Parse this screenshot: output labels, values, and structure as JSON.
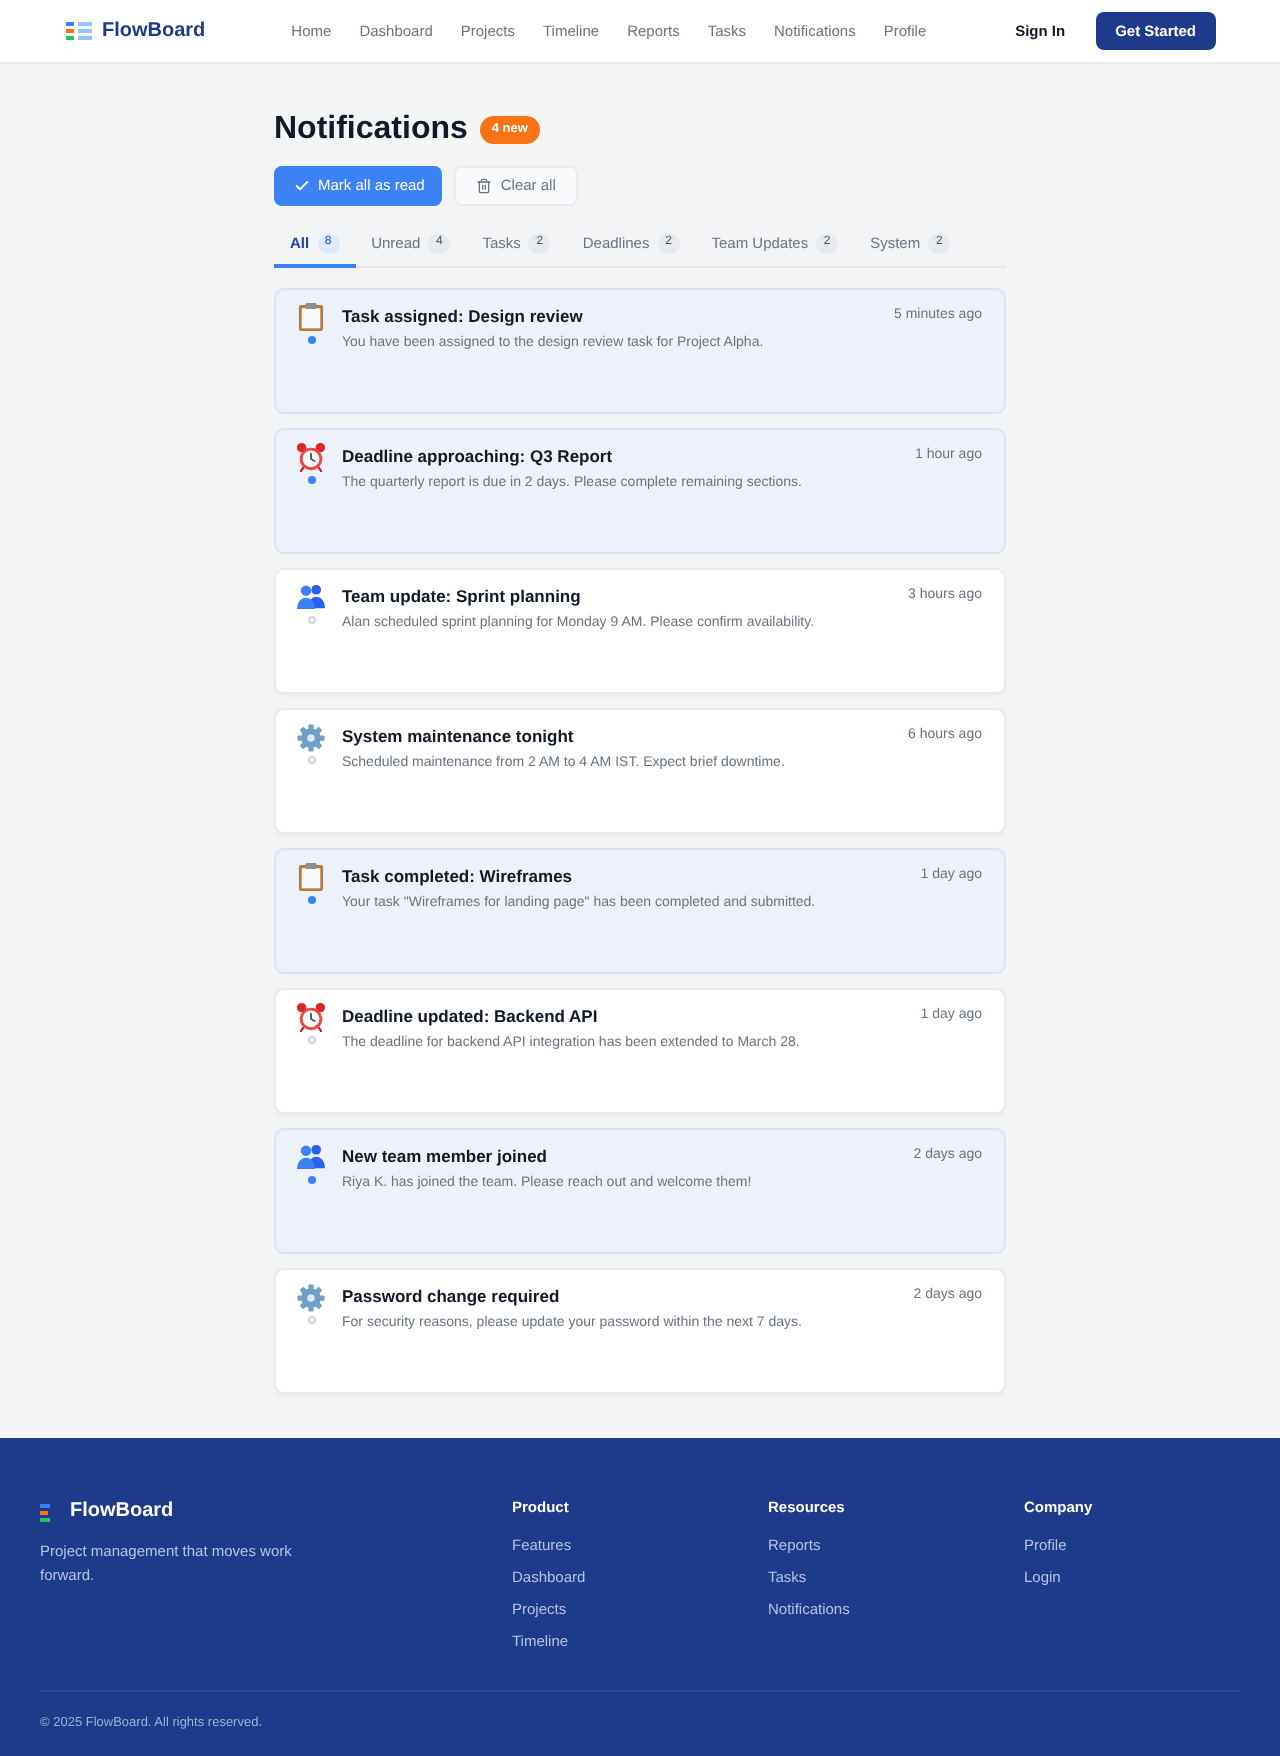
{
  "header": {
    "brand": "FlowBoard",
    "nav": [
      "Home",
      "Dashboard",
      "Projects",
      "Timeline",
      "Reports",
      "Tasks",
      "Notifications",
      "Profile"
    ],
    "sign_in": "Sign In",
    "cta": "Get Started"
  },
  "page": {
    "title": "Notifications",
    "badge": "4 new",
    "actions": [
      {
        "kind": "mark_read",
        "label": "Mark all as read"
      },
      {
        "kind": "clear",
        "label": "Clear all"
      }
    ]
  },
  "tabs": [
    {
      "label": "All",
      "count": "8",
      "selected": true
    },
    {
      "label": "Unread",
      "count": "4",
      "selected": false
    },
    {
      "label": "Tasks",
      "count": "2",
      "selected": false
    },
    {
      "label": "Deadlines",
      "count": "2",
      "selected": false
    },
    {
      "label": "Team Updates",
      "count": "2",
      "selected": false
    },
    {
      "label": "System",
      "count": "2",
      "selected": false
    }
  ],
  "notifications": [
    {
      "kind": "task",
      "title": "Task assigned: Design review",
      "message": "You have been assigned to the design review task for Project Alpha.",
      "time": "5 minutes ago",
      "unread": true
    },
    {
      "kind": "deadline",
      "title": "Deadline approaching: Q3 Report",
      "message": "The quarterly report is due in 2 days. Please complete remaining sections.",
      "time": "1 hour ago",
      "unread": true
    },
    {
      "kind": "team",
      "title": "Team update: Sprint planning",
      "message": "Alan scheduled sprint planning for Monday 9 AM. Please confirm availability.",
      "time": "3 hours ago",
      "unread": false
    },
    {
      "kind": "system",
      "title": "System maintenance tonight",
      "message": "Scheduled maintenance from 2 AM to 4 AM IST. Expect brief downtime.",
      "time": "6 hours ago",
      "unread": false
    },
    {
      "kind": "task",
      "title": "Task completed: Wireframes",
      "message": "Your task \"Wireframes for landing page\" has been completed and submitted.",
      "time": "1 day ago",
      "unread": true
    },
    {
      "kind": "deadline",
      "title": "Deadline updated: Backend API",
      "message": "The deadline for backend API integration has been extended to March 28.",
      "time": "1 day ago",
      "unread": false
    },
    {
      "kind": "team",
      "title": "New team member joined",
      "message": "Riya K. has joined the team. Please reach out and welcome them!",
      "time": "2 days ago",
      "unread": true
    },
    {
      "kind": "system",
      "title": "Password change required",
      "message": "For security reasons, please update your password within the next 7 days.",
      "time": "2 days ago",
      "unread": false
    }
  ],
  "footer": {
    "brand": "FlowBoard",
    "tagline": "Project management that moves work forward.",
    "columns": [
      {
        "heading": "Product",
        "links": [
          "Features",
          "Dashboard",
          "Projects",
          "Timeline"
        ]
      },
      {
        "heading": "Resources",
        "links": [
          "Reports",
          "Tasks",
          "Notifications"
        ]
      },
      {
        "heading": "Company",
        "links": [
          "Profile",
          "Login"
        ]
      }
    ],
    "copyright": "© 2025 FlowBoard. All rights reserved."
  }
}
